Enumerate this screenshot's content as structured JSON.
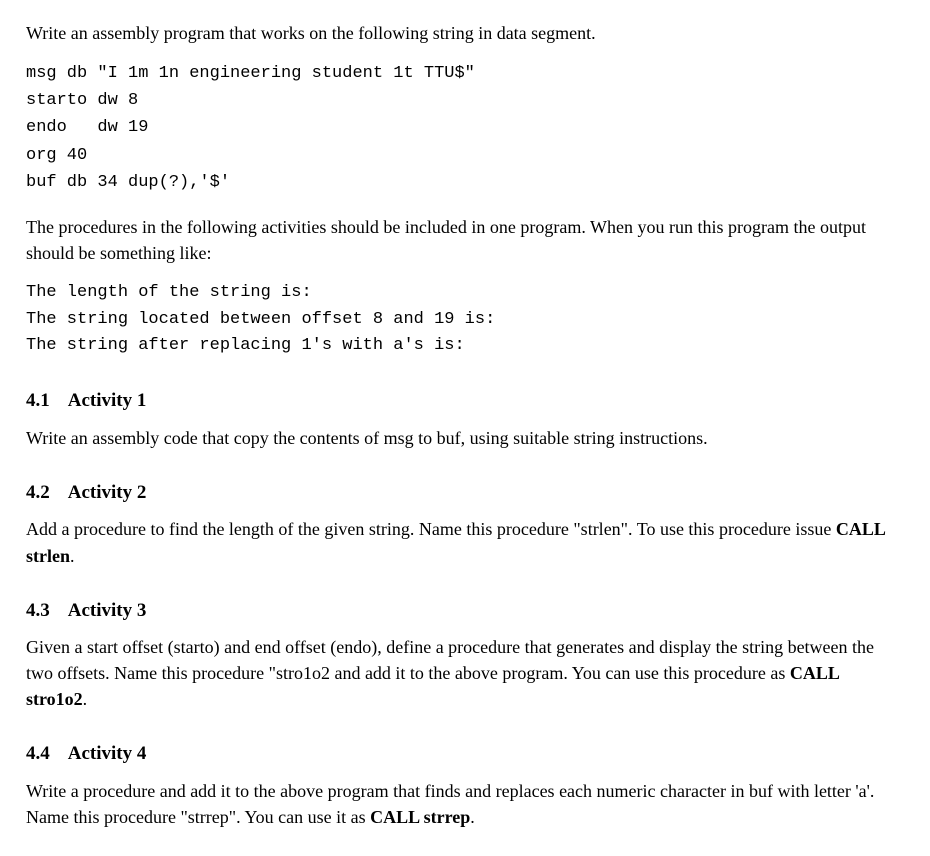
{
  "intro": "Write an assembly program that works on the following string in data segment.",
  "code": {
    "l1": "msg db \"I 1m 1n engineering student 1t TTU$\"",
    "l2": "starto dw 8",
    "l3": "endo   dw 19",
    "l4": "org 40",
    "l5": "buf db 34 dup(?),'$'"
  },
  "para2": "The procedures in the following activities should be included in one program. When you run this program the output should be something like:",
  "output": {
    "l1": "The length of the string is:",
    "l2": "The string located between offset 8 and 19 is:",
    "l3": "The string after replacing 1's with a's is:"
  },
  "s41": {
    "num": "4.1",
    "title": "Activity 1",
    "body": "Write an assembly code that copy the contents of msg to buf, using suitable string instructions."
  },
  "s42": {
    "num": "4.2",
    "title": "Activity 2",
    "body_a": "Add a procedure to find the length of the given string. Name this procedure \"strlen\". To use this procedure issue ",
    "call": "CALL strlen",
    "body_b": "."
  },
  "s43": {
    "num": "4.3",
    "title": "Activity 3",
    "body_a": "Given a start offset (starto) and end offset (endo), define a procedure that generates and display the string between the two offsets. Name this procedure \"stro1o2 and add it to the above program. You can use this procedure as ",
    "call": "CALL stro1o2",
    "body_b": "."
  },
  "s44": {
    "num": "4.4",
    "title": "Activity 4",
    "body_a": "Write a procedure and add it to the above program that finds and replaces each numeric character in buf with letter 'a'. Name this procedure \"strrep\". You can use it as ",
    "call": "CALL strrep",
    "body_b": "."
  }
}
